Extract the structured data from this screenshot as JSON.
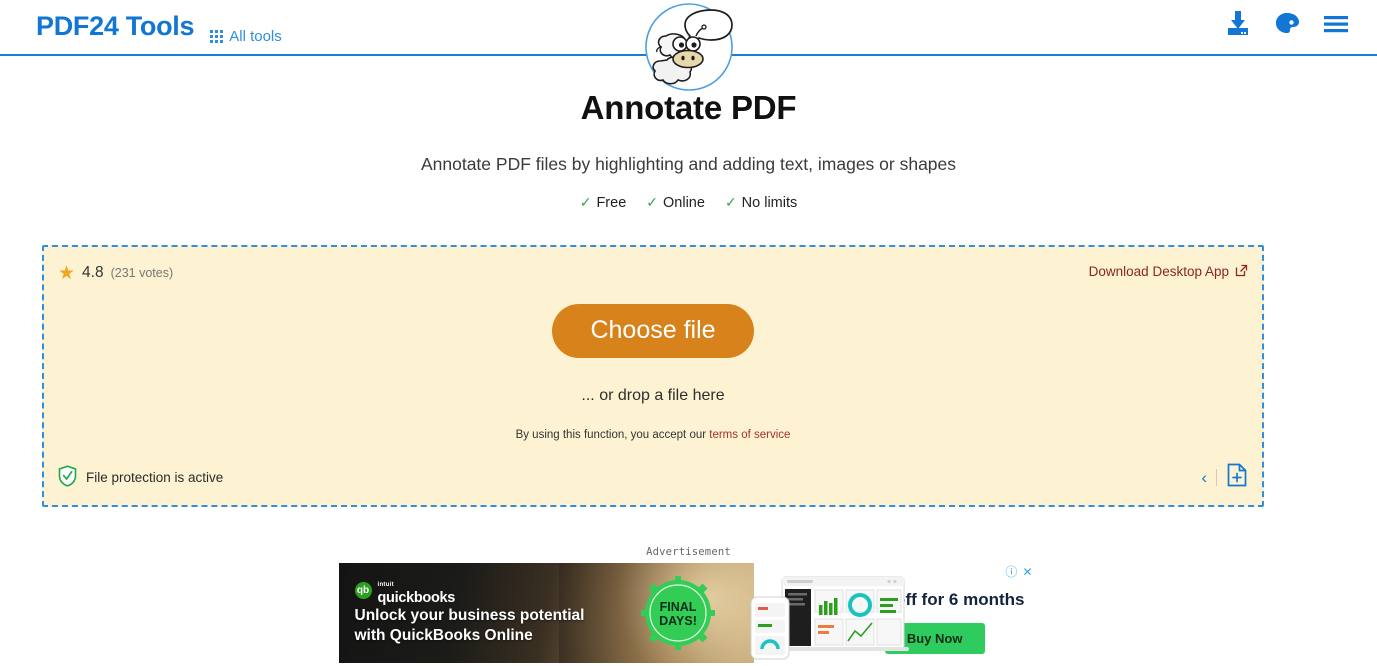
{
  "header": {
    "brand": "PDF24 Tools",
    "all_tools_label": "All tools",
    "icons": [
      {
        "name": "download-icon"
      },
      {
        "name": "palette-icon"
      },
      {
        "name": "hamburger-menu-icon"
      }
    ],
    "mascot_alt": "pdf24-sheep-mascot",
    "accent_color": "#1277d4"
  },
  "hero": {
    "title": "Annotate PDF",
    "subtitle": "Annotate PDF files by highlighting and adding text, images or shapes",
    "features": [
      {
        "check": "✓",
        "label": "Free"
      },
      {
        "check": "✓",
        "label": "Online"
      },
      {
        "check": "✓",
        "label": "No limits"
      }
    ],
    "check_color": "#35a853"
  },
  "dropzone": {
    "rating": {
      "star": "★",
      "value": "4.8",
      "votes": "(231 votes)",
      "star_color": "#eda720"
    },
    "desktop_app_label": "Download Desktop App",
    "choose_file_label": "Choose file",
    "choose_file_color": "#d8821b",
    "drop_hint": "... or drop a file here",
    "terms_prefix": "By using this function, you accept our ",
    "terms_link": "terms of service",
    "protection_label": "File protection is active",
    "protection_color": "#1fa74a",
    "border_color": "#2f8ede",
    "background_color": "#fdf3d3",
    "prev_label": "‹"
  },
  "ad": {
    "label": "Advertisement",
    "brand_intuit": "intuit",
    "brand_name": "quickbooks",
    "headline_line1": "Unlock your business potential",
    "headline_line2": "with QuickBooks Online",
    "badge_line1": "FINAL",
    "badge_line2": "DAYS!",
    "offer": "90% off  for 6 months",
    "cta_label": "Buy Now",
    "cta_color": "#2ecc5f",
    "info_icon": "ⓘ",
    "close_icon": "✕"
  }
}
